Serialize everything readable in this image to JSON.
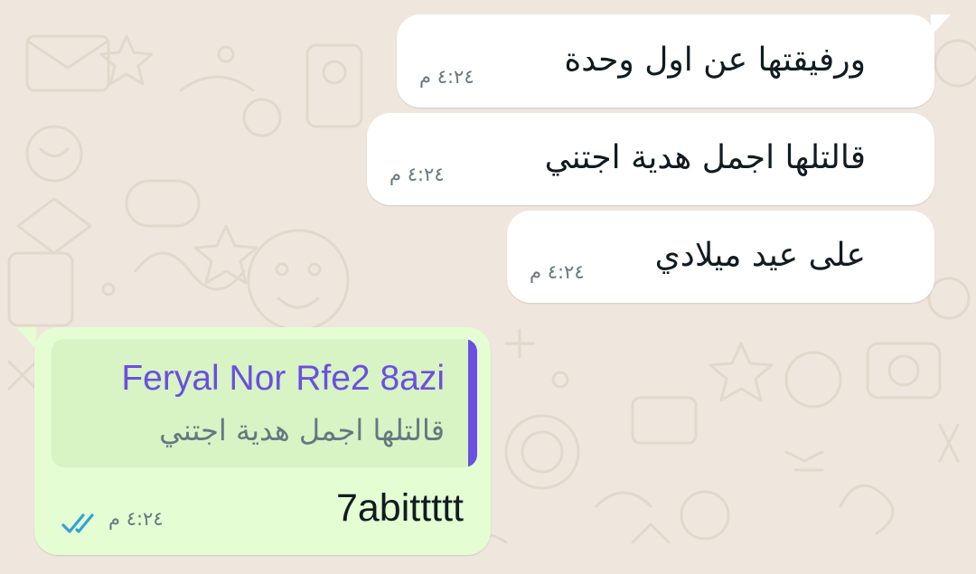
{
  "colors": {
    "chat_background": "#efe7dd",
    "incoming_bubble": "#ffffff",
    "outgoing_bubble": "#e4fdd2",
    "quote_background": "#d8f3c4",
    "quote_accent": "#6a4fe0",
    "read_ticks": "#34a2d8",
    "timestamp": "#667781"
  },
  "messages": [
    {
      "text": "ورفيقتها عن اول وحدة",
      "time": "٤:٢٤ م"
    },
    {
      "text": "قالتلها اجمل هدية اجتني",
      "time": "٤:٢٤ م"
    },
    {
      "text": "على عيد ميلادي",
      "time": "٤:٢٤ م"
    }
  ],
  "reply": {
    "quoted_author": "Feryal Nor Rfe2 8azi",
    "quoted_text": "قالتلها اجمل هدية اجتني",
    "text": "7abittttt",
    "time": "٤:٢٤ م",
    "status_icon": "double-check-read-icon"
  }
}
